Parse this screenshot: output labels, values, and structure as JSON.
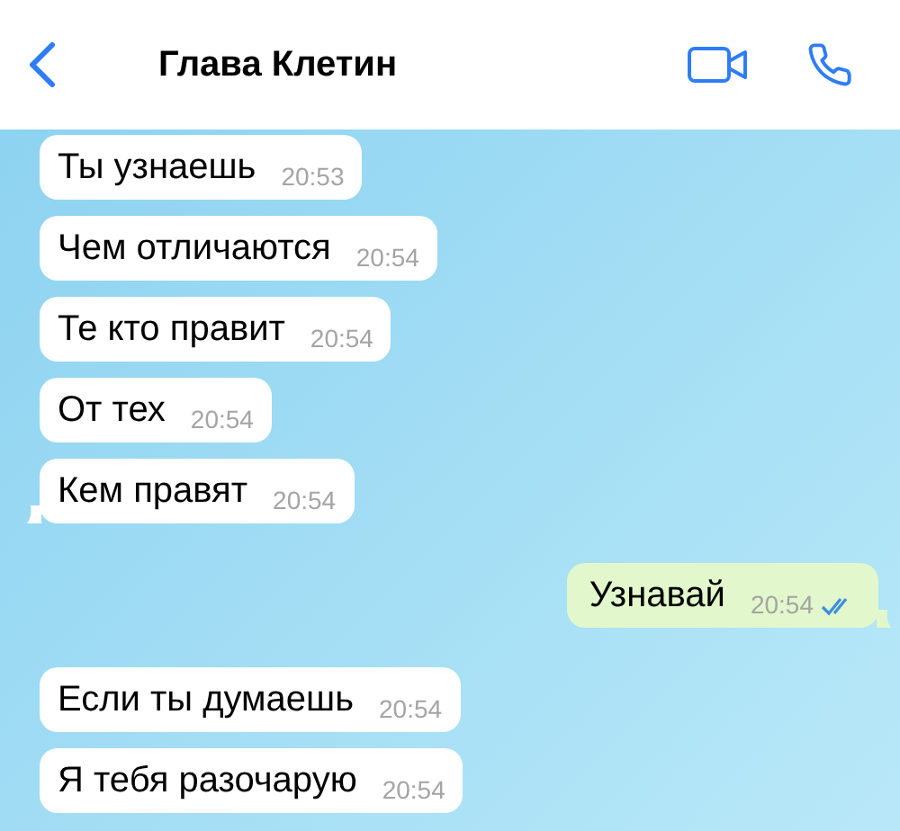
{
  "header": {
    "title": "Глава Клетин"
  },
  "messages": [
    {
      "kind": "incoming",
      "text": "Ты узнаешь",
      "time": "20:53",
      "tail": false
    },
    {
      "kind": "incoming",
      "text": "Чем отличаются",
      "time": "20:54",
      "tail": false
    },
    {
      "kind": "incoming",
      "text": "Те кто правит",
      "time": "20:54",
      "tail": false
    },
    {
      "kind": "incoming",
      "text": "От тех",
      "time": "20:54",
      "tail": false
    },
    {
      "kind": "incoming",
      "text": "Кем правят",
      "time": "20:54",
      "tail": true
    },
    {
      "kind": "outgoing",
      "text": "Узнавай",
      "time": "20:54",
      "tail": true,
      "read": true
    },
    {
      "kind": "incoming",
      "text": "Если ты думаешь",
      "time": "20:54",
      "tail": false
    },
    {
      "kind": "incoming",
      "text": "Я тебя разочарую",
      "time": "20:54",
      "tail": false
    }
  ]
}
